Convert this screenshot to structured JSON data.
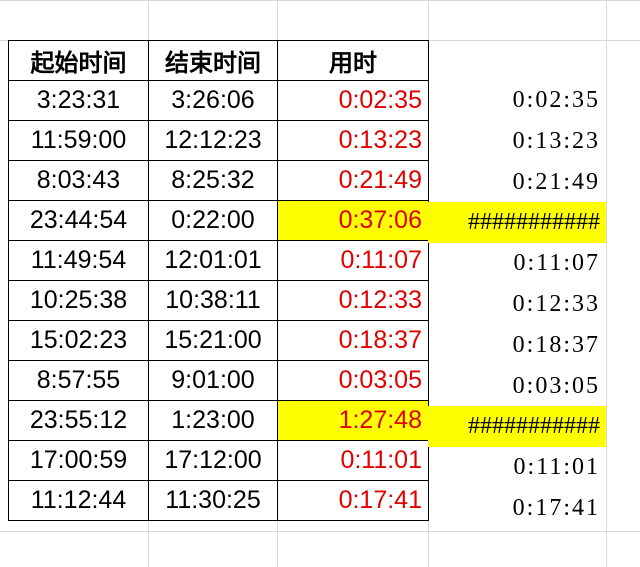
{
  "table": {
    "headers": [
      "起始时间",
      "结束时间",
      "用时"
    ],
    "rows": [
      {
        "start": "3:23:31",
        "end": "3:26:06",
        "duration": "0:02:35",
        "extra": "0:02:35",
        "highlight": false
      },
      {
        "start": "11:59:00",
        "end": "12:12:23",
        "duration": "0:13:23",
        "extra": "0:13:23",
        "highlight": false
      },
      {
        "start": "8:03:43",
        "end": "8:25:32",
        "duration": "0:21:49",
        "extra": "0:21:49",
        "highlight": false
      },
      {
        "start": "23:44:54",
        "end": "0:22:00",
        "duration": "0:37:06",
        "extra": "###########",
        "highlight": true
      },
      {
        "start": "11:49:54",
        "end": "12:01:01",
        "duration": "0:11:07",
        "extra": "0:11:07",
        "highlight": false
      },
      {
        "start": "10:25:38",
        "end": "10:38:11",
        "duration": "0:12:33",
        "extra": "0:12:33",
        "highlight": false
      },
      {
        "start": "15:02:23",
        "end": "15:21:00",
        "duration": "0:18:37",
        "extra": "0:18:37",
        "highlight": false
      },
      {
        "start": "8:57:55",
        "end": "9:01:00",
        "duration": "0:03:05",
        "extra": "0:03:05",
        "highlight": false
      },
      {
        "start": "23:55:12",
        "end": "1:23:00",
        "duration": "1:27:48",
        "extra": "###########",
        "highlight": true
      },
      {
        "start": "17:00:59",
        "end": "17:12:00",
        "duration": "0:11:01",
        "extra": "0:11:01",
        "highlight": false
      },
      {
        "start": "11:12:44",
        "end": "11:30:25",
        "duration": "0:17:41",
        "extra": "0:17:41",
        "highlight": false
      }
    ]
  },
  "colors": {
    "duration_text": "#e00000",
    "highlight_fill": "#ffff00",
    "border": "#000000",
    "gridline": "#d9d9d9"
  }
}
